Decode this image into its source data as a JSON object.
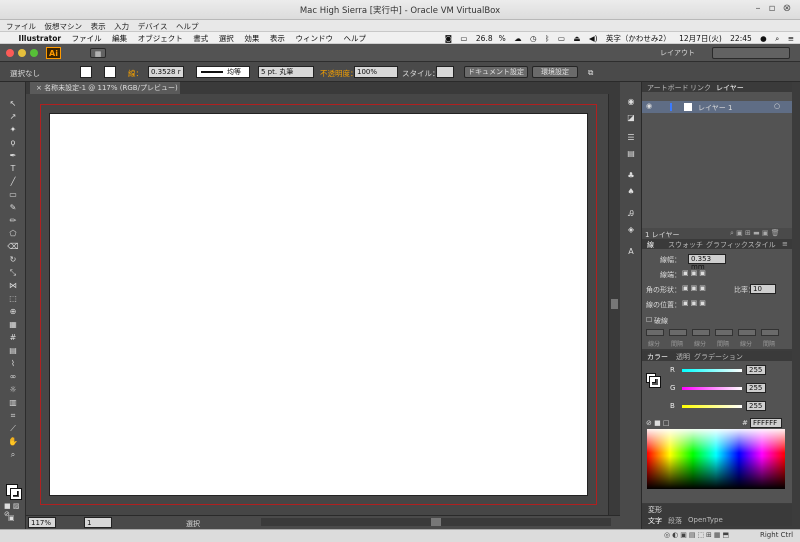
{
  "vbox": {
    "title": "Mac High Sierra [実行中] - Oracle VM VirtualBox",
    "menu": [
      "ファイル",
      "仮想マシン",
      "表示",
      "入力",
      "デバイス",
      "ヘルプ"
    ],
    "host_key": "Right Ctrl"
  },
  "mac": {
    "app": "Illustrator",
    "menu": [
      "ファイル",
      "編集",
      "オブジェクト",
      "書式",
      "選択",
      "効果",
      "表示",
      "ウィンドウ",
      "ヘルプ"
    ],
    "battery": "26.8",
    "input": "英字（かわせみ2）",
    "date": "12月7日(火)",
    "time": "22:45"
  },
  "app": {
    "logo": "Ai",
    "workspace": "レイアウト",
    "control": {
      "selection": "選択なし",
      "stroke_label": "線：",
      "stroke_value": "0.3528 r",
      "profile": "均等",
      "brush": "5 pt. 丸筆",
      "opacity_label": "不透明度：",
      "opacity": "100%",
      "style_label": "スタイル：",
      "doc_setup": "ドキュメント設定",
      "prefs": "環境設定"
    },
    "doc_tab": "名称未設定-1 @ 117% (RGB/プレビュー)",
    "status": {
      "zoom": "117%",
      "page": "1",
      "tool": "選択"
    }
  },
  "layers_panel": {
    "tabs": [
      "アートボード",
      "リンク",
      "レイヤー"
    ],
    "layer_name": "レイヤー 1",
    "count": "1 レイヤー"
  },
  "stroke_panel": {
    "tabs": [
      "線",
      "スウォッチ",
      "グラフィックスタイル"
    ],
    "weight_label": "線幅：",
    "weight": "0.353 mm",
    "cap_label": "線端：",
    "corner_label": "角の形状：",
    "limit_label": "比率：",
    "limit": "10",
    "align_label": "線の位置：",
    "dashed": "破線",
    "dash_labels": [
      "線分",
      "間隔",
      "線分",
      "間隔",
      "線分",
      "間隔"
    ]
  },
  "color_panel": {
    "tabs": [
      "カラー",
      "透明",
      "グラデーション"
    ],
    "r": "255",
    "g": "255",
    "b": "255",
    "r_label": "R",
    "g_label": "G",
    "b_label": "B",
    "hex": "FFFFFF"
  },
  "bottom_panel": {
    "tabs": [
      "変形"
    ],
    "tabs2": [
      "文字",
      "段落",
      "OpenType"
    ]
  }
}
